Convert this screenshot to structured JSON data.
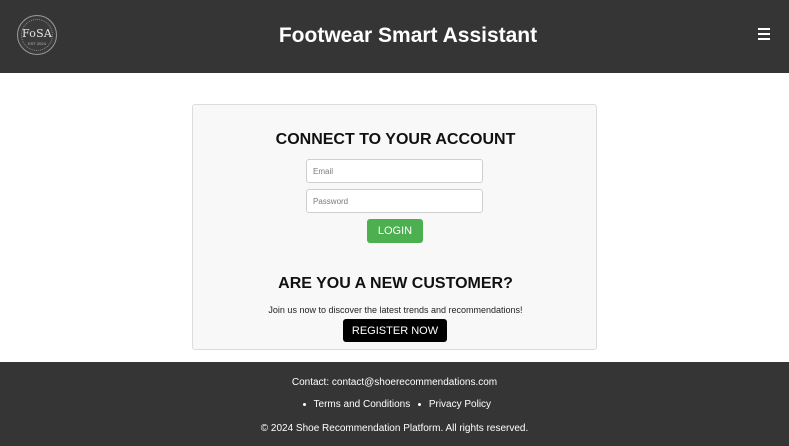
{
  "header": {
    "logo": {
      "text": "FoSA",
      "subtext": "EST 2024"
    },
    "title": "Footwear Smart Assistant",
    "menu_icon": "hamburger-menu-icon"
  },
  "login": {
    "heading": "CONNECT TO YOUR ACCOUNT",
    "email_placeholder": "Email",
    "password_placeholder": "Password",
    "login_label": "LOGIN"
  },
  "register": {
    "heading": "ARE YOU A NEW CUSTOMER?",
    "description": "Join us now to discover the latest trends and recommendations!",
    "button_label": "REGISTER NOW"
  },
  "footer": {
    "contact_label": "Contact:",
    "contact_email": "contact@shoerecommendations.com",
    "terms_label": "Terms and Conditions",
    "privacy_label": "Privacy Policy",
    "copyright": "© 2024 Shoe Recommendation Platform. All rights reserved."
  },
  "colors": {
    "header_bg": "#353535",
    "footer_bg": "#353535",
    "login_button": "#4caf50",
    "register_button": "#000000"
  }
}
